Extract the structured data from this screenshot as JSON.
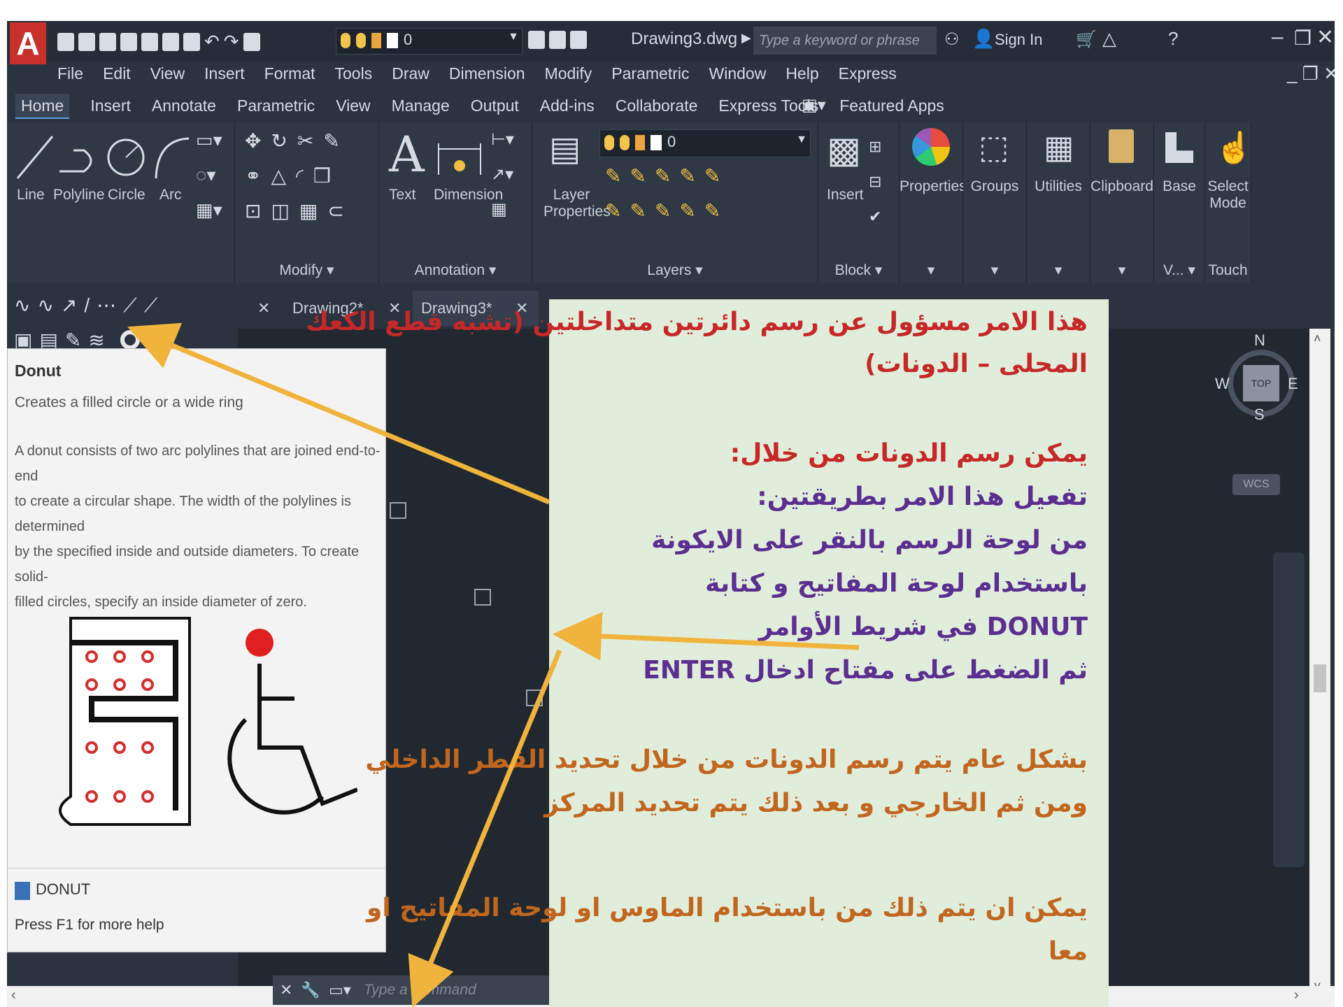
{
  "titlebar": {
    "app_letter": "A",
    "layer_value": "0",
    "filename": "Drawing3.dwg",
    "search_placeholder": "Type a keyword or phrase",
    "sign_in": "Sign In"
  },
  "menu": [
    "File",
    "Edit",
    "View",
    "Insert",
    "Format",
    "Tools",
    "Draw",
    "Dimension",
    "Modify",
    "Parametric",
    "Window",
    "Help",
    "Express"
  ],
  "ribbon_tabs": [
    "Home",
    "Insert",
    "Annotate",
    "Parametric",
    "View",
    "Manage",
    "Output",
    "Add-ins",
    "Collaborate",
    "Express Tools",
    "Featured Apps"
  ],
  "draw_tools": [
    "Line",
    "Polyline",
    "Circle",
    "Arc"
  ],
  "panels": {
    "modify": "Modify ▾",
    "text": "Text",
    "dimension": "Dimension",
    "annotation": "Annotation ▾",
    "layer_properties_1": "Layer",
    "layer_properties_2": "Properties",
    "layers": "Layers ▾",
    "layer_dropdown_value": "0",
    "insert": "Insert",
    "block": "Block ▾",
    "properties": "Properties",
    "groups": "Groups",
    "utilities": "Utilities",
    "clipboard": "Clipboard",
    "base": "Base",
    "view_short": "V... ▾",
    "select_mode_1": "Select",
    "select_mode_2": "Mode",
    "touch": "Touch"
  },
  "doc_tabs": [
    "Drawing2*",
    "Drawing3*"
  ],
  "tooltip": {
    "title": "Donut",
    "subtitle": "Creates a filled circle or a wide ring",
    "body": [
      "A donut consists of two arc polylines that are joined end-to-end",
      "to create a circular shape. The width of the polylines is determined",
      "by the specified inside and outside diameters. To create solid-",
      "filled circles, specify an inside diameter of zero."
    ],
    "command": "DONUT",
    "help": "Press F1 for more help"
  },
  "viewcube": {
    "n": "N",
    "s": "S",
    "e": "E",
    "w": "W",
    "top": "TOP",
    "wcs": "WCS"
  },
  "command_line_placeholder": "Type a command",
  "note": {
    "lines": [
      {
        "text": "هذا الامر مسؤول عن رسم دائرتين متداخلتين (تشبه قطع الكعك",
        "color": "red"
      },
      {
        "text": "المحلى – الدونات)",
        "color": "red"
      },
      {
        "text": "يمكن رسم الدونات من خلال:",
        "color": "red"
      },
      {
        "text": "تفعيل هذا الامر بطريقتين:",
        "color": "purple"
      },
      {
        "text": "من لوحة الرسم بالنقر على الايكونة",
        "color": "purple"
      },
      {
        "text": "باستخدام لوحة المفاتيح و كتابة",
        "color": "purple"
      },
      {
        "text": "DONUT  في شريط الأوامر",
        "color": "purple"
      },
      {
        "text": "ثم الضغط على مفتاح ادخال   ENTER",
        "color": "purple"
      },
      {
        "text": "بشكل عام يتم رسم الدونات من خلال تحديد  القطر الداخلي",
        "color": "orange"
      },
      {
        "text": "ومن ثم الخارجي و بعد ذلك يتم تحديد المركز",
        "color": "orange"
      },
      {
        "text": "يمكن ان يتم ذلك من باستخدام الماوس او لوحة المفاتيح او",
        "color": "orange"
      },
      {
        "text": "معا",
        "color": "orange"
      }
    ]
  },
  "colors": {
    "red": "#c62828",
    "purple": "#5b2f8f",
    "orange": "#c0661f",
    "arrow": "#f0b43c",
    "note_bg": "#e1eddb"
  }
}
